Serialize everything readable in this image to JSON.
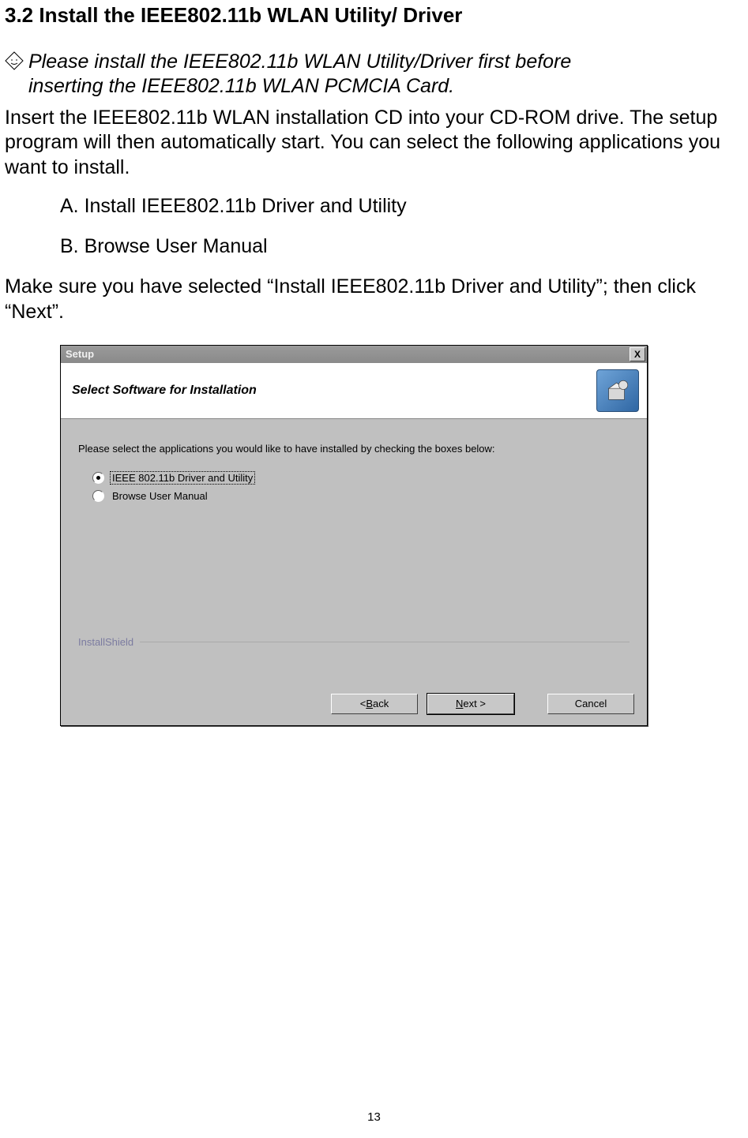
{
  "section_title": "3.2 Install the IEEE802.11b WLAN Utility/ Driver",
  "note_icon_name": "note-diamond-icon",
  "note_line1": "Please install the IEEE802.11b WLAN Utility/Driver first before",
  "note_line2": "inserting the IEEE802.11b WLAN PCMCIA Card.",
  "para1": "Insert the IEEE802.11b WLAN installation CD into your CD-ROM drive. The setup program will then automatically start. You can select the following applications you want to install.",
  "list": {
    "itemA": "A. Install IEEE802.11b Driver and Utility",
    "itemB": "B. Browse User Manual"
  },
  "para2": "Make sure you have selected “Install IEEE802.11b Driver and Utility”; then click “Next”.",
  "dialog": {
    "titlebar": "Setup",
    "close_label": "X",
    "heading": "Select Software for Installation",
    "install_icon_name": "install-box-icon",
    "prompt": "Please select the applications you would like to have installed by checking the boxes below:",
    "options": {
      "opt1": {
        "label": "IEEE 802.11b Driver and Utility",
        "selected": true
      },
      "opt2": {
        "label": "Browse User Manual",
        "selected": false
      }
    },
    "brand": "InstallShield",
    "buttons": {
      "back_prefix": "< ",
      "back_u": "B",
      "back_suffix": "ack",
      "next_u": "N",
      "next_suffix": "ext >",
      "cancel": "Cancel"
    }
  },
  "page_number": "13"
}
